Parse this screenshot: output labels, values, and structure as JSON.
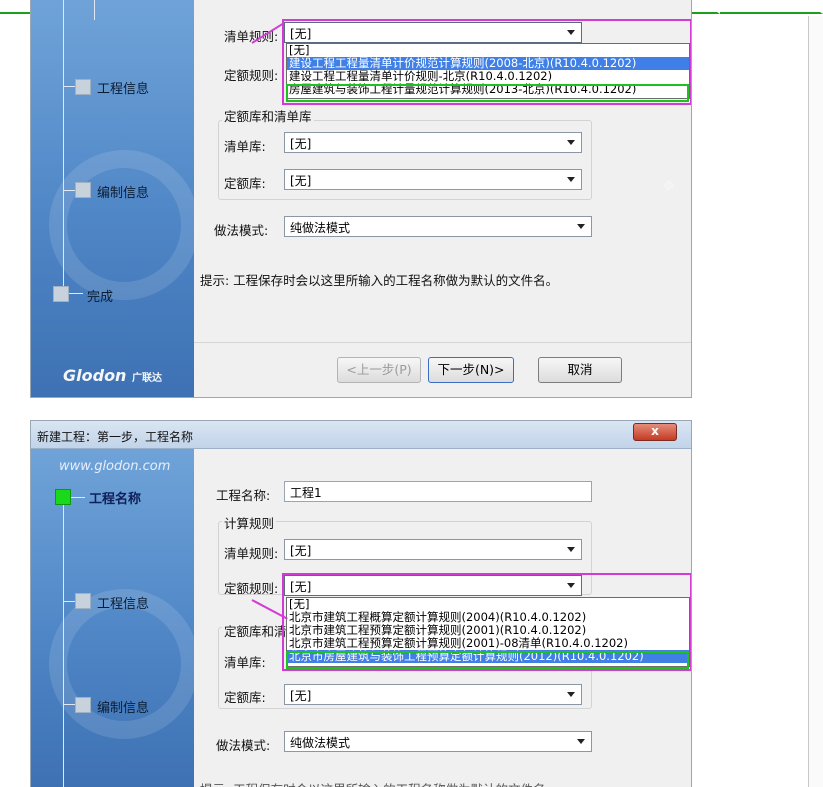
{
  "panel1": {
    "sidebar": {
      "steps": [
        {
          "label": "工程信息"
        },
        {
          "label": "编制信息"
        },
        {
          "label": "完成"
        }
      ],
      "brand": "Glodon",
      "brand_cn": "广联达"
    },
    "labels": {
      "list_rule": "清单规则:",
      "quota_rule": "定额规则:",
      "group_libs": "定额库和清单库",
      "list_lib": "清单库:",
      "quota_lib": "定额库:",
      "method_mode": "做法模式:",
      "hint": "提示: 工程保存时会以这里所输入的工程名称做为默认的文件名。"
    },
    "values": {
      "list_rule": "[无]",
      "list_lib": "[无]",
      "quota_lib": "[无]",
      "method_mode": "纯做法模式"
    },
    "dropdown": [
      "[无]",
      "建设工程工程量清单计价规范计算规则(2008-北京)(R10.4.0.1202)",
      "建设工程工程量清单计价规则-北京(R10.4.0.1202)",
      "房屋建筑与装饰工程计量规范计算规则(2013-北京)(R10.4.0.1202)"
    ],
    "buttons": {
      "prev": "<上一步(P)",
      "next": "下一步(N)>",
      "cancel": "取消"
    }
  },
  "panel2": {
    "title": "新建工程：第一步，工程名称",
    "close": "x",
    "sidebar": {
      "www": "www.glodon.com",
      "steps": [
        {
          "label": "工程名称"
        },
        {
          "label": "工程信息"
        },
        {
          "label": "编制信息"
        }
      ]
    },
    "labels": {
      "project_name": "工程名称:",
      "calc_rules": "计算规则",
      "list_rule": "清单规则:",
      "quota_rule": "定额规则:",
      "group_libs": "定额库和清单库",
      "list_lib": "清单库:",
      "quota_lib": "定额库:",
      "method_mode": "做法模式:"
    },
    "values": {
      "project_name": "工程1",
      "list_rule": "[无]",
      "quota_rule": "[无]",
      "quota_lib": "[无]",
      "method_mode": "纯做法模式"
    },
    "dropdown": [
      "[无]",
      "北京市建筑工程概算定额计算规则(2004)(R10.4.0.1202)",
      "北京市建筑工程预算定额计算规则(2001)(R10.4.0.1202)",
      "北京市建筑工程预算定额计算规则(2001)-08清单(R10.4.0.1202)",
      "北京市房屋建筑与装饰工程预算定额计算规则(2012)(R10.4.0.1202)"
    ],
    "footer_hint": "提示: 工程保存时会以这里所输入的工程名称做为默认的文件名。"
  },
  "colors": {
    "highlight_magenta": "#d33ad6",
    "highlight_green": "#21c021",
    "selection_blue": "#3f7fe6",
    "step_active": "#1ad81a"
  }
}
